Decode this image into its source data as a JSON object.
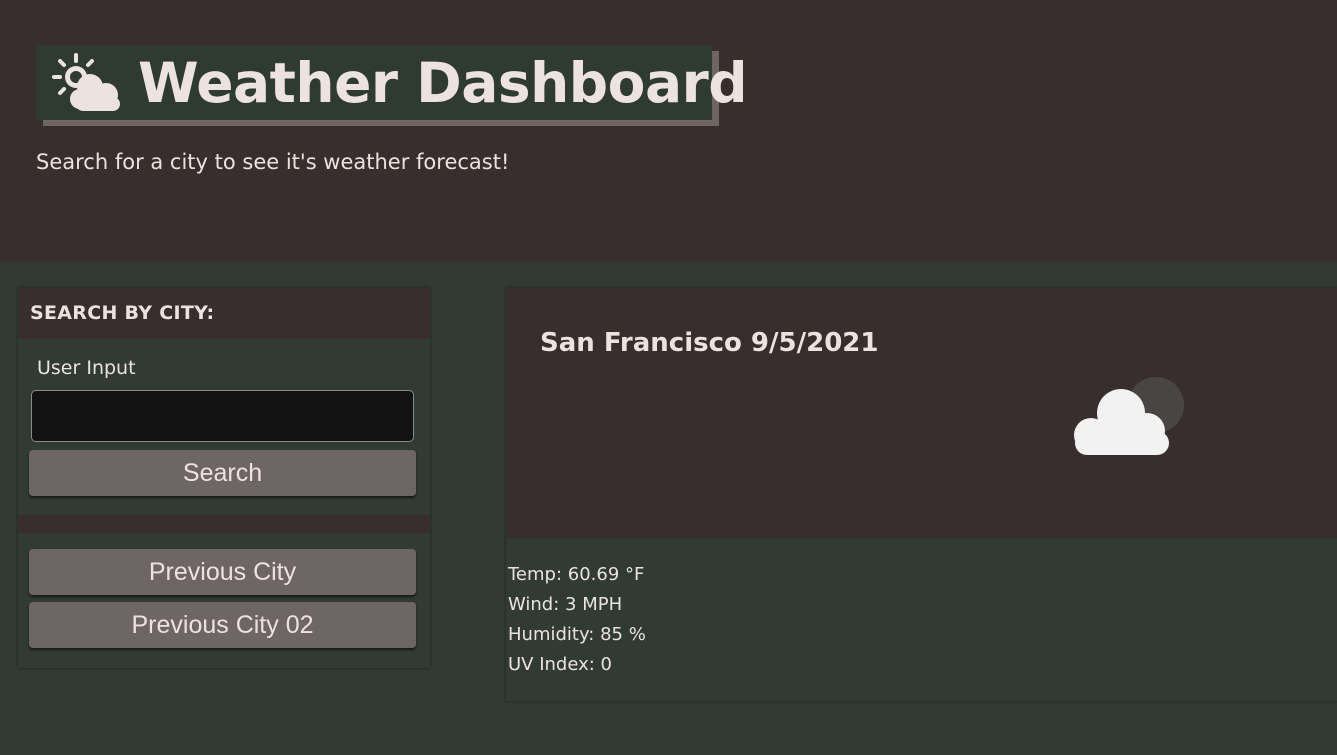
{
  "header": {
    "title": "Weather Dashboard",
    "title_icon": "sun-behind-cloud-icon",
    "subtitle": "Search for a city to see it's weather forecast!"
  },
  "sidebar": {
    "heading": "SEARCH BY CITY:",
    "input_label": "User Input",
    "input_value": "",
    "search_label": "Search",
    "history": [
      "Previous City",
      "Previous City 02"
    ]
  },
  "current": {
    "city_date": "San Francisco 9/5/2021",
    "icon": "cloud-night-icon",
    "temp": "Temp: 60.69 °F",
    "wind": "Wind: 3 MPH",
    "humidity": "Humidity: 85 %",
    "uv": "UV Index: 0"
  },
  "colors": {
    "header_bg": "#382e2e",
    "page_bg": "#313a33",
    "button_bg": "#6e6666",
    "text": "#ece3e0"
  }
}
